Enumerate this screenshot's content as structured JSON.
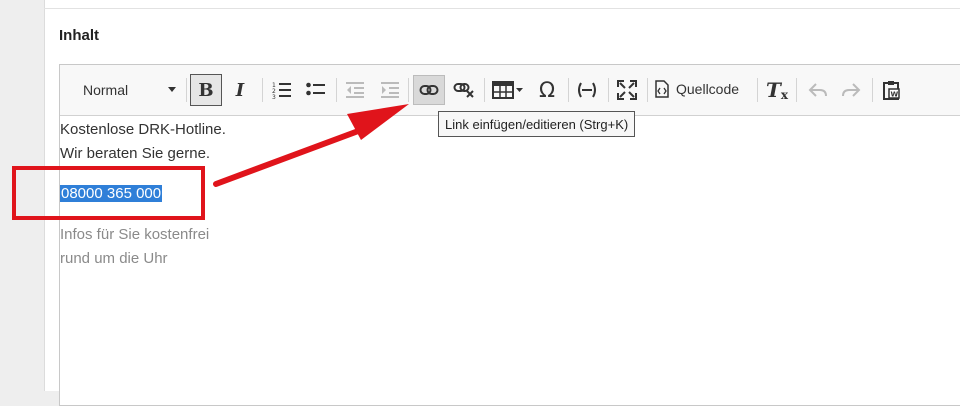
{
  "section": {
    "label": "Inhalt"
  },
  "toolbar": {
    "format": "Normal",
    "bold": "B",
    "italic": "I",
    "source_label": "Quellcode"
  },
  "tooltip": "Link einfügen/editieren (Strg+K)",
  "content": {
    "line1": "Kostenlose DRK-Hotline.",
    "line2": "Wir beraten Sie gerne.",
    "phone": "08000 365 000",
    "line4": "Infos für Sie kostenfrei",
    "line5": "rund um die Uhr"
  },
  "colors": {
    "annotation": "#e0141b",
    "selection": "#2f7fd8",
    "link_button_active": "#d9d9d9"
  },
  "icons": [
    "numbered-list-icon",
    "bulleted-list-icon",
    "outdent-icon",
    "indent-icon",
    "link-icon",
    "unlink-icon",
    "table-icon",
    "special-char-icon",
    "horizontal-line-icon",
    "maximize-icon",
    "source-icon",
    "remove-format-icon",
    "undo-icon",
    "redo-icon",
    "paste-from-word-icon"
  ]
}
